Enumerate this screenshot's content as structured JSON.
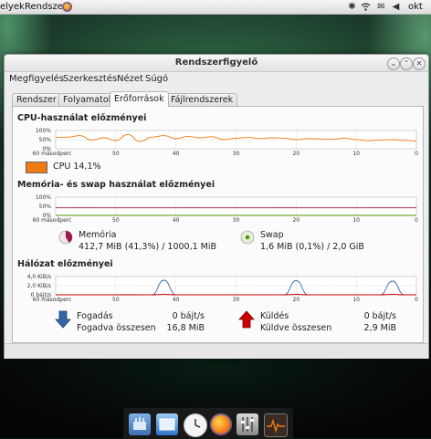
{
  "panel": {
    "places_label": "elyek",
    "system_label": "Rendszer",
    "clock_label": "okt"
  },
  "window": {
    "title": "Rendszerfigyelő",
    "menu": [
      "Megfigyelés",
      "Szerkesztés",
      "Nézet",
      "Súgó"
    ],
    "tabs": [
      "Rendszer",
      "Folyamatok",
      "Erőforrások",
      "Fájlrendszerek"
    ],
    "active_tab": "Erőforrások"
  },
  "cpu": {
    "title": "CPU-használat előzményei",
    "y_ticks": [
      "100%",
      "50%",
      "0%"
    ],
    "x_ticks": [
      "60 másodperc",
      "50",
      "40",
      "30",
      "20",
      "10",
      "0"
    ],
    "legend": "CPU  14,1%",
    "color": "#f07a12"
  },
  "memory": {
    "title": "Memória- és swap használat előzményei",
    "y_ticks": [
      "100%",
      "50%",
      "0%"
    ],
    "x_ticks": [
      "60 másodperc",
      "50",
      "40",
      "30",
      "20",
      "10",
      "0"
    ],
    "mem_label": "Memória",
    "mem_value": "412,7 MiB (41,3%) / 1000,1 MiB",
    "mem_color": "#9d1a4e",
    "swap_label": "Swap",
    "swap_value": "1,6 MiB (0,1%) / 2,0 GiB",
    "swap_color": "#4e9a06"
  },
  "network": {
    "title": "Hálózat előzményei",
    "y_ticks": [
      "4,0 KiB/s",
      "2,0 KiB/s",
      "0 bájt/s"
    ],
    "x_ticks": [
      "60 másodperc",
      "50",
      "40",
      "30",
      "20",
      "10",
      "0"
    ],
    "recv_label": "Fogadás",
    "recv_rate": "0 bájt/s",
    "recv_total_label": "Fogadva összesen",
    "recv_total": "16,8 MiB",
    "send_label": "Küldés",
    "send_rate": "0 bájt/s",
    "send_total_label": "Küldve összesen",
    "send_total": "2,9 MiB",
    "recv_color": "#3465a4",
    "send_color": "#cc0000"
  },
  "chart_data": [
    {
      "type": "line",
      "x": [
        60,
        58,
        56,
        54,
        52,
        50,
        48,
        46,
        44,
        42,
        40,
        38,
        36,
        34,
        32,
        30,
        28,
        26,
        24,
        22,
        20,
        18,
        16,
        14,
        12,
        10,
        8,
        6,
        4,
        2,
        0
      ],
      "series": [
        {
          "name": "CPU",
          "values": [
            62,
            64,
            72,
            48,
            60,
            45,
            78,
            40,
            64,
            72,
            55,
            68,
            60,
            66,
            50,
            58,
            62,
            56,
            60,
            58,
            50,
            56,
            54,
            52,
            58,
            50,
            44,
            48,
            50,
            46,
            42
          ]
        }
      ],
      "ylim": [
        0,
        100
      ]
    },
    {
      "type": "line",
      "x": [
        60,
        0
      ],
      "series": [
        {
          "name": "Memória",
          "values": [
            41.3,
            41.3
          ]
        },
        {
          "name": "Swap",
          "values": [
            0.1,
            0.1
          ]
        }
      ],
      "ylim": [
        0,
        100
      ]
    },
    {
      "type": "line",
      "x": [
        60,
        56,
        52,
        48,
        44,
        42,
        40,
        38,
        36,
        34,
        32,
        28,
        24,
        22,
        20,
        18,
        16,
        12,
        8,
        6,
        4,
        2,
        0
      ],
      "series": [
        {
          "name": "Fogadás",
          "values": [
            0,
            0,
            0,
            0.05,
            0,
            3.2,
            0,
            0,
            0,
            0,
            0,
            0,
            0,
            0,
            3.1,
            0,
            0,
            0,
            0,
            0,
            3.0,
            0,
            0
          ]
        },
        {
          "name": "Küldés",
          "values": [
            0,
            0,
            0,
            0,
            0,
            0.1,
            0,
            0,
            0,
            0,
            0,
            0,
            0,
            0,
            0.1,
            0,
            0,
            0,
            0,
            0,
            0.1,
            0,
            0
          ]
        }
      ],
      "ylim": [
        0,
        4
      ]
    }
  ]
}
